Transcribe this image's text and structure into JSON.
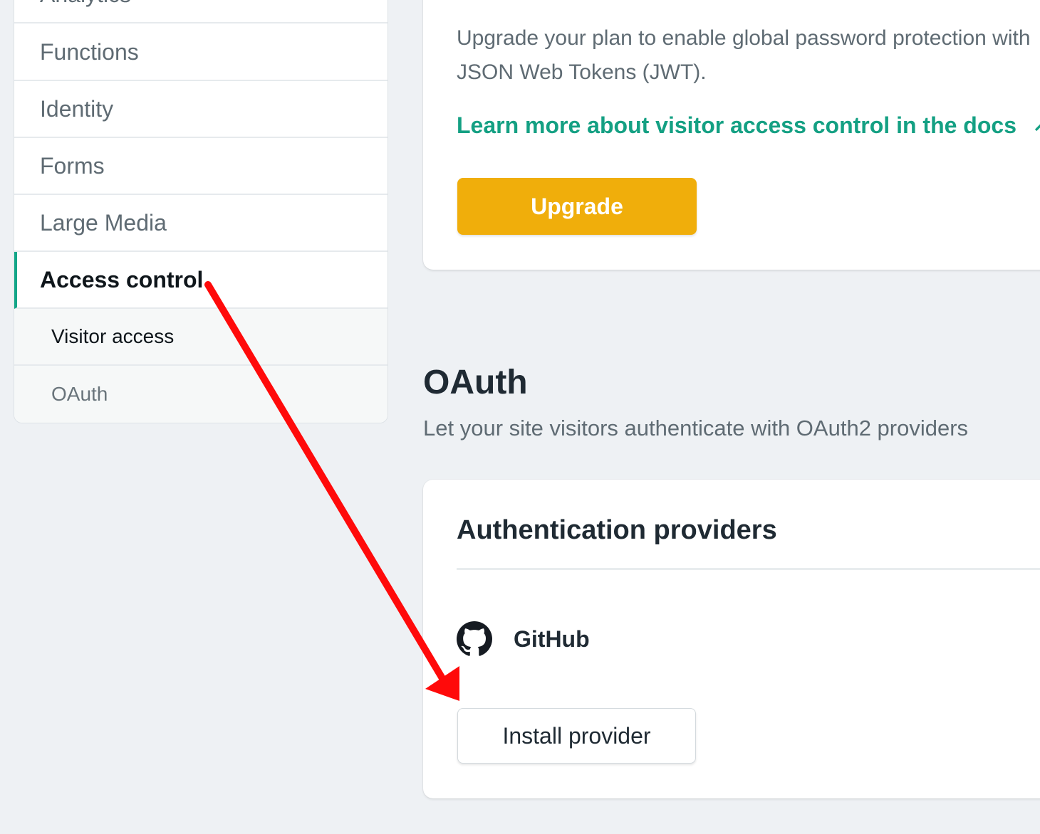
{
  "sidebar": {
    "items": [
      {
        "label": "Analytics"
      },
      {
        "label": "Functions"
      },
      {
        "label": "Identity"
      },
      {
        "label": "Forms"
      },
      {
        "label": "Large Media"
      },
      {
        "label": "Access control",
        "active": true
      }
    ],
    "subitems": [
      {
        "label": "Visitor access",
        "current": true
      },
      {
        "label": "OAuth"
      }
    ]
  },
  "password_protection": {
    "description": "Upgrade your plan to enable global password protection with JSON Web Tokens (JWT).",
    "docs_link": "Learn more about visitor access control in the docs",
    "docs_link_icon": "external-arrow-icon",
    "upgrade_label": "Upgrade"
  },
  "oauth": {
    "title": "OAuth",
    "subtitle": "Let your site visitors authenticate with OAuth2 providers",
    "card_title": "Authentication providers",
    "provider_name": "GitHub",
    "provider_icon": "github-icon",
    "install_label": "Install provider"
  },
  "colors": {
    "accent": "#14a083",
    "upgrade_button": "#f0ae0b",
    "annotation_arrow": "#ff0000",
    "background": "#eef1f4"
  }
}
